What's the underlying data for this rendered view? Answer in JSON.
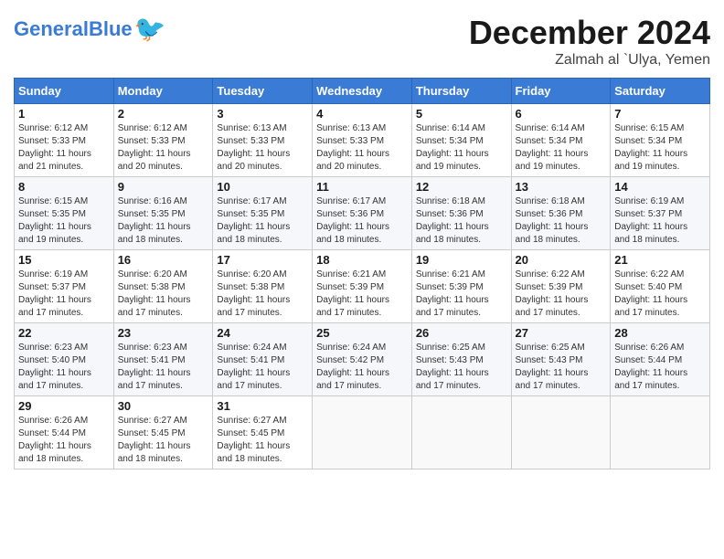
{
  "header": {
    "logo_text1": "General",
    "logo_text2": "Blue",
    "month": "December 2024",
    "location": "Zalmah al `Ulya, Yemen"
  },
  "weekdays": [
    "Sunday",
    "Monday",
    "Tuesday",
    "Wednesday",
    "Thursday",
    "Friday",
    "Saturday"
  ],
  "weeks": [
    [
      {
        "day": "1",
        "info": "Sunrise: 6:12 AM\nSunset: 5:33 PM\nDaylight: 11 hours\nand 21 minutes."
      },
      {
        "day": "2",
        "info": "Sunrise: 6:12 AM\nSunset: 5:33 PM\nDaylight: 11 hours\nand 20 minutes."
      },
      {
        "day": "3",
        "info": "Sunrise: 6:13 AM\nSunset: 5:33 PM\nDaylight: 11 hours\nand 20 minutes."
      },
      {
        "day": "4",
        "info": "Sunrise: 6:13 AM\nSunset: 5:33 PM\nDaylight: 11 hours\nand 20 minutes."
      },
      {
        "day": "5",
        "info": "Sunrise: 6:14 AM\nSunset: 5:34 PM\nDaylight: 11 hours\nand 19 minutes."
      },
      {
        "day": "6",
        "info": "Sunrise: 6:14 AM\nSunset: 5:34 PM\nDaylight: 11 hours\nand 19 minutes."
      },
      {
        "day": "7",
        "info": "Sunrise: 6:15 AM\nSunset: 5:34 PM\nDaylight: 11 hours\nand 19 minutes."
      }
    ],
    [
      {
        "day": "8",
        "info": "Sunrise: 6:15 AM\nSunset: 5:35 PM\nDaylight: 11 hours\nand 19 minutes."
      },
      {
        "day": "9",
        "info": "Sunrise: 6:16 AM\nSunset: 5:35 PM\nDaylight: 11 hours\nand 18 minutes."
      },
      {
        "day": "10",
        "info": "Sunrise: 6:17 AM\nSunset: 5:35 PM\nDaylight: 11 hours\nand 18 minutes."
      },
      {
        "day": "11",
        "info": "Sunrise: 6:17 AM\nSunset: 5:36 PM\nDaylight: 11 hours\nand 18 minutes."
      },
      {
        "day": "12",
        "info": "Sunrise: 6:18 AM\nSunset: 5:36 PM\nDaylight: 11 hours\nand 18 minutes."
      },
      {
        "day": "13",
        "info": "Sunrise: 6:18 AM\nSunset: 5:36 PM\nDaylight: 11 hours\nand 18 minutes."
      },
      {
        "day": "14",
        "info": "Sunrise: 6:19 AM\nSunset: 5:37 PM\nDaylight: 11 hours\nand 18 minutes."
      }
    ],
    [
      {
        "day": "15",
        "info": "Sunrise: 6:19 AM\nSunset: 5:37 PM\nDaylight: 11 hours\nand 17 minutes."
      },
      {
        "day": "16",
        "info": "Sunrise: 6:20 AM\nSunset: 5:38 PM\nDaylight: 11 hours\nand 17 minutes."
      },
      {
        "day": "17",
        "info": "Sunrise: 6:20 AM\nSunset: 5:38 PM\nDaylight: 11 hours\nand 17 minutes."
      },
      {
        "day": "18",
        "info": "Sunrise: 6:21 AM\nSunset: 5:39 PM\nDaylight: 11 hours\nand 17 minutes."
      },
      {
        "day": "19",
        "info": "Sunrise: 6:21 AM\nSunset: 5:39 PM\nDaylight: 11 hours\nand 17 minutes."
      },
      {
        "day": "20",
        "info": "Sunrise: 6:22 AM\nSunset: 5:39 PM\nDaylight: 11 hours\nand 17 minutes."
      },
      {
        "day": "21",
        "info": "Sunrise: 6:22 AM\nSunset: 5:40 PM\nDaylight: 11 hours\nand 17 minutes."
      }
    ],
    [
      {
        "day": "22",
        "info": "Sunrise: 6:23 AM\nSunset: 5:40 PM\nDaylight: 11 hours\nand 17 minutes."
      },
      {
        "day": "23",
        "info": "Sunrise: 6:23 AM\nSunset: 5:41 PM\nDaylight: 11 hours\nand 17 minutes."
      },
      {
        "day": "24",
        "info": "Sunrise: 6:24 AM\nSunset: 5:41 PM\nDaylight: 11 hours\nand 17 minutes."
      },
      {
        "day": "25",
        "info": "Sunrise: 6:24 AM\nSunset: 5:42 PM\nDaylight: 11 hours\nand 17 minutes."
      },
      {
        "day": "26",
        "info": "Sunrise: 6:25 AM\nSunset: 5:43 PM\nDaylight: 11 hours\nand 17 minutes."
      },
      {
        "day": "27",
        "info": "Sunrise: 6:25 AM\nSunset: 5:43 PM\nDaylight: 11 hours\nand 17 minutes."
      },
      {
        "day": "28",
        "info": "Sunrise: 6:26 AM\nSunset: 5:44 PM\nDaylight: 11 hours\nand 17 minutes."
      }
    ],
    [
      {
        "day": "29",
        "info": "Sunrise: 6:26 AM\nSunset: 5:44 PM\nDaylight: 11 hours\nand 18 minutes."
      },
      {
        "day": "30",
        "info": "Sunrise: 6:27 AM\nSunset: 5:45 PM\nDaylight: 11 hours\nand 18 minutes."
      },
      {
        "day": "31",
        "info": "Sunrise: 6:27 AM\nSunset: 5:45 PM\nDaylight: 11 hours\nand 18 minutes."
      },
      {
        "day": "",
        "info": ""
      },
      {
        "day": "",
        "info": ""
      },
      {
        "day": "",
        "info": ""
      },
      {
        "day": "",
        "info": ""
      }
    ]
  ]
}
